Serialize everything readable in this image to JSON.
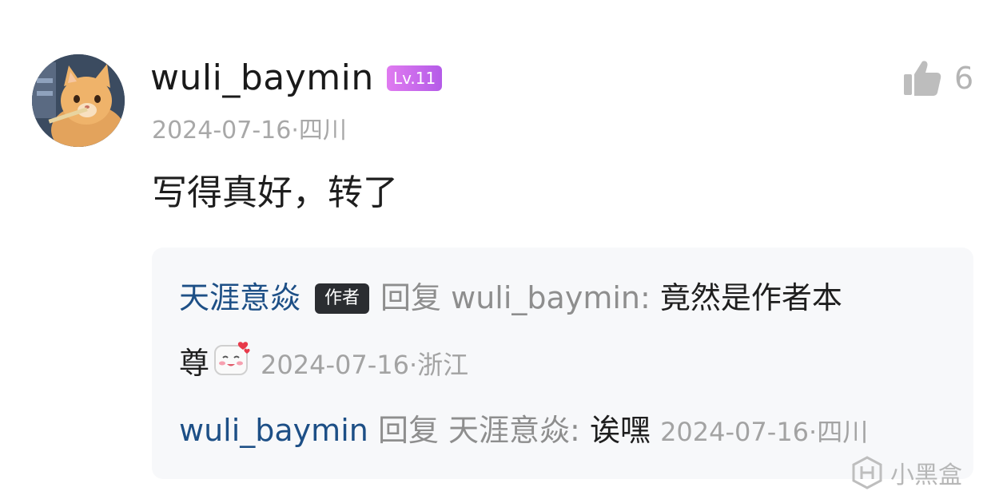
{
  "comment": {
    "username": "wuli_baymin",
    "level_badge": "Lv.11",
    "date": "2024-07-16",
    "location": "四川",
    "separator": "·",
    "text": "写得真好，转了",
    "like_count": "6",
    "avatar_icon": "cat-avatar-icon",
    "like_icon": "thumbs-up-icon"
  },
  "replies": [
    {
      "author": "天涯意焱",
      "author_badge": "作者",
      "reply_word": "回复",
      "target": "wuli_baymin:",
      "content_line1": "竟然是作者本",
      "content_line2": "尊",
      "emoji": "blushing-face-emoji",
      "date": "2024-07-16",
      "separator": "·",
      "location": "浙江"
    },
    {
      "author": "wuli_baymin",
      "reply_word": "回复",
      "target": "天涯意焱:",
      "content": "诶嘿",
      "date": "2024-07-16",
      "separator": "·",
      "location": "四川"
    }
  ],
  "watermark": {
    "text": "小黑盒",
    "icon": "heybox-logo-icon"
  },
  "colors": {
    "link": "#1d4f86",
    "level_badge": "#c86cf0",
    "author_badge": "#2b2d31",
    "muted": "#a8a8a8",
    "reply_bg": "#f7f8fa"
  }
}
